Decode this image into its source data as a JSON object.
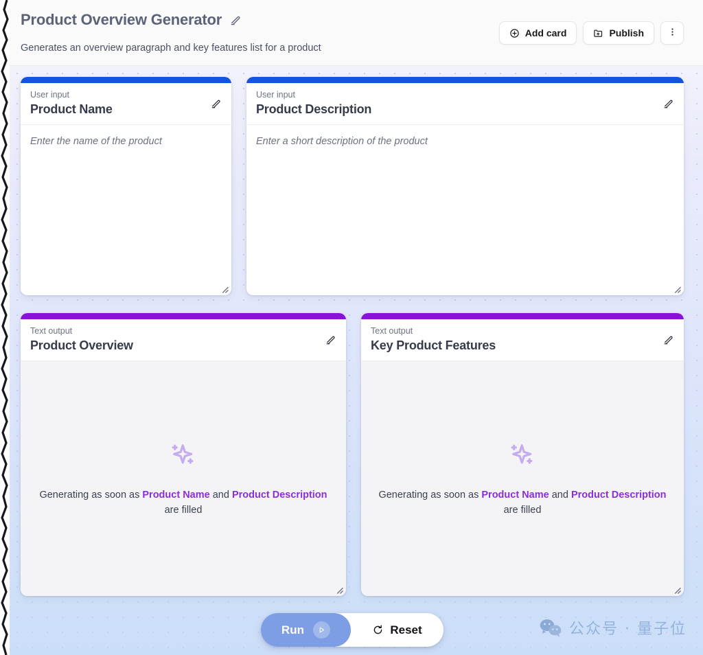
{
  "header": {
    "title": "Product Overview Generator",
    "subtitle": "Generates an overview paragraph and key features list for a product",
    "edit_icon": "pencil-icon",
    "actions": {
      "add_card": "Add card",
      "add_card_icon": "plus-circle-icon",
      "publish": "Publish",
      "publish_icon": "folder-plus-icon",
      "more_icon": "three-dots-vertical-icon"
    }
  },
  "cards": [
    {
      "kind": "User input",
      "title": "Product Name",
      "placeholder": "Enter the name of the product",
      "accent": "#1452e0",
      "type": "input"
    },
    {
      "kind": "User input",
      "title": "Product Description",
      "placeholder": "Enter a short description of the product",
      "accent": "#1452e0",
      "type": "input"
    },
    {
      "kind": "Text output",
      "title": "Product Overview",
      "accent": "#8a12d8",
      "type": "output",
      "state_icon": "sparkles-icon",
      "state_prefix": "Generating as soon as ",
      "state_ref1": "Product Name",
      "state_middle": " and ",
      "state_ref2": "Product Description",
      "state_suffix": " are filled"
    },
    {
      "kind": "Text output",
      "title": "Key Product Features",
      "accent": "#8a12d8",
      "type": "output",
      "state_icon": "sparkles-icon",
      "state_prefix": "Generating as soon as ",
      "state_ref1": "Product Name",
      "state_middle": " and ",
      "state_ref2": "Product Description",
      "state_suffix": " are filled"
    }
  ],
  "action_bar": {
    "run_label": "Run",
    "run_icon": "play-icon",
    "reset_label": "Reset",
    "reset_icon": "refresh-icon"
  },
  "watermark": {
    "text": "公众号 · 量子位",
    "icon": "wechat-icon"
  },
  "colors": {
    "input_accent": "#1452e0",
    "output_accent": "#8a12d8",
    "reference_purple": "#8b2fd4",
    "run_blue": "#7d9de4"
  }
}
